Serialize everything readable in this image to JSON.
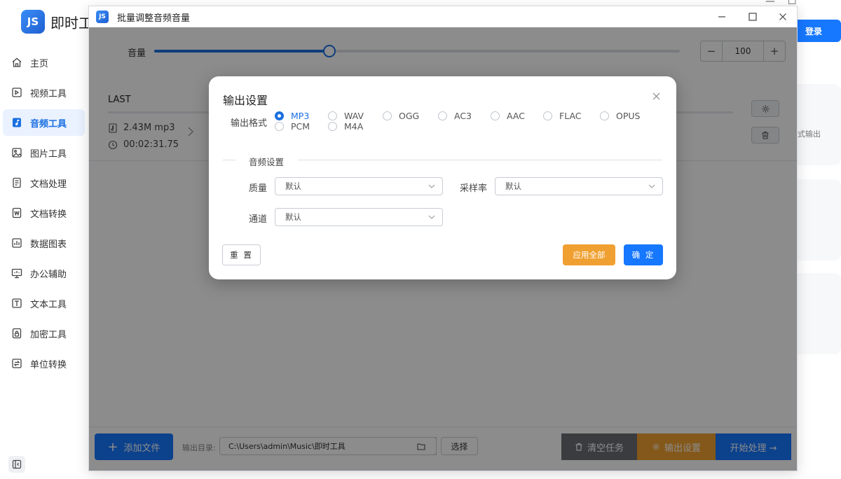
{
  "app": {
    "brand_logo": "JS",
    "brand_title": "即时工",
    "login_label": "登录",
    "right_card_text": "式输出"
  },
  "sidebar": {
    "items": [
      {
        "label": "主页",
        "icon": "home-icon"
      },
      {
        "label": "视频工具",
        "icon": "video-icon"
      },
      {
        "label": "音频工具",
        "icon": "audio-icon"
      },
      {
        "label": "图片工具",
        "icon": "image-icon"
      },
      {
        "label": "文档处理",
        "icon": "document-icon"
      },
      {
        "label": "文档转换",
        "icon": "word-icon"
      },
      {
        "label": "数据图表",
        "icon": "chart-icon"
      },
      {
        "label": "办公辅助",
        "icon": "monitor-icon"
      },
      {
        "label": "文本工具",
        "icon": "text-icon"
      },
      {
        "label": "加密工具",
        "icon": "lock-icon"
      },
      {
        "label": "单位转换",
        "icon": "convert-icon"
      }
    ],
    "active_index": 2
  },
  "dialog": {
    "title": "批量调整音频音量",
    "logo": "JS",
    "volume_label": "音量",
    "volume_value": "100",
    "volume_fraction": 0.333,
    "file": {
      "name": "LAST",
      "size": "2.43M mp3",
      "duration": "00:02:31.75"
    },
    "bottom": {
      "add_file": "添加文件",
      "output_dir_label": "输出目录:",
      "output_dir_value": "C:\\Users\\admin\\Music\\即时工具",
      "select_label": "选择",
      "clear_label": "清空任务",
      "output_settings_label": "输出设置",
      "start_label": "开始处理 →"
    }
  },
  "modal": {
    "title": "输出设置",
    "format_label": "输出格式",
    "formats": [
      "MP3",
      "WAV",
      "OGG",
      "AC3",
      "AAC",
      "FLAC",
      "OPUS",
      "PCM",
      "M4A"
    ],
    "selected_format": "MP3",
    "audio_section": "音频设置",
    "quality_label": "质量",
    "quality_value": "默认",
    "sample_rate_label": "采样率",
    "sample_rate_value": "默认",
    "channel_label": "通道",
    "channel_value": "默认",
    "reset_label": "重 置",
    "apply_all_label": "应用全部",
    "confirm_label": "确 定"
  },
  "colors": {
    "accent": "#1677ff",
    "orange": "#f0a030",
    "gray_btn": "#6b6e73",
    "overlay": "rgba(0,0,0,0.45)"
  }
}
